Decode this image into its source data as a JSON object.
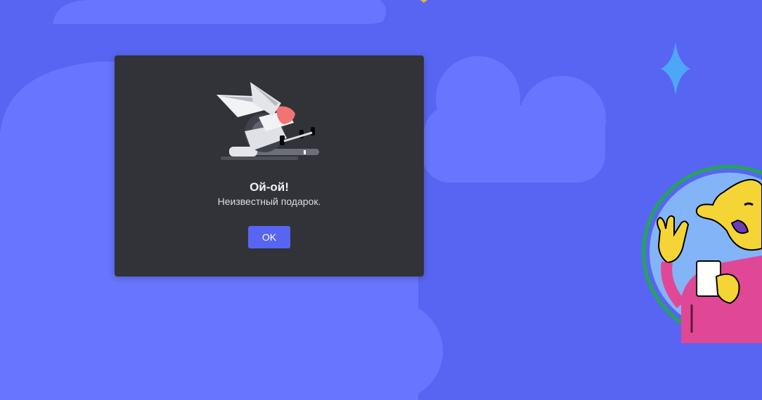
{
  "modal": {
    "title": "Ой-ой!",
    "message": "Неизвестный подарок.",
    "ok_label": "OK",
    "illustration": "broken-robot-arm-illustration"
  },
  "background": {
    "decorations": [
      "cloud",
      "sparkle-icon",
      "character-avatar"
    ]
  },
  "colors": {
    "background": "#5865f2",
    "cloud": "#6876ff",
    "modal": "#313338",
    "button": "#5865f2",
    "avatar_ring": "#23a55a",
    "sparkle": "#4ea6f6"
  }
}
